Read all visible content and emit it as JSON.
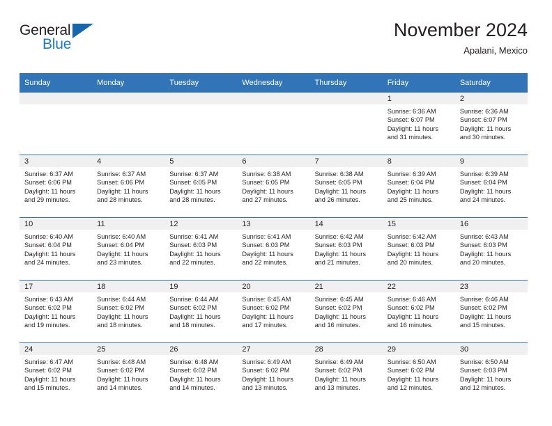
{
  "brand": {
    "name_part1": "General",
    "name_part2": "Blue",
    "triangle_color": "#1666ae",
    "blue_text_color": "#1f7bc1"
  },
  "header": {
    "title": "November 2024",
    "subtitle": "Apalani, Mexico"
  },
  "theme": {
    "header_bg": "#3174b8",
    "header_text": "#ffffff",
    "daynum_band_bg": "#f0f0f0",
    "cell_bg": "#ffffff",
    "divider": "#3174b8",
    "text": "#231f20"
  },
  "weekday_headers": [
    "Sunday",
    "Monday",
    "Tuesday",
    "Wednesday",
    "Thursday",
    "Friday",
    "Saturday"
  ],
  "labels": {
    "sunrise_prefix": "Sunrise:",
    "sunset_prefix": "Sunset:",
    "daylight_prefix": "Daylight:"
  },
  "weeks": [
    [
      {
        "empty": true
      },
      {
        "empty": true
      },
      {
        "empty": true
      },
      {
        "empty": true
      },
      {
        "empty": true
      },
      {
        "empty": false,
        "day": "1",
        "sunrise": "Sunrise: 6:36 AM",
        "sunset": "Sunset: 6:07 PM",
        "daylight_l1": "Daylight: 11 hours",
        "daylight_l2": "and 31 minutes."
      },
      {
        "empty": false,
        "day": "2",
        "sunrise": "Sunrise: 6:36 AM",
        "sunset": "Sunset: 6:07 PM",
        "daylight_l1": "Daylight: 11 hours",
        "daylight_l2": "and 30 minutes."
      }
    ],
    [
      {
        "empty": false,
        "day": "3",
        "sunrise": "Sunrise: 6:37 AM",
        "sunset": "Sunset: 6:06 PM",
        "daylight_l1": "Daylight: 11 hours",
        "daylight_l2": "and 29 minutes."
      },
      {
        "empty": false,
        "day": "4",
        "sunrise": "Sunrise: 6:37 AM",
        "sunset": "Sunset: 6:06 PM",
        "daylight_l1": "Daylight: 11 hours",
        "daylight_l2": "and 28 minutes."
      },
      {
        "empty": false,
        "day": "5",
        "sunrise": "Sunrise: 6:37 AM",
        "sunset": "Sunset: 6:05 PM",
        "daylight_l1": "Daylight: 11 hours",
        "daylight_l2": "and 28 minutes."
      },
      {
        "empty": false,
        "day": "6",
        "sunrise": "Sunrise: 6:38 AM",
        "sunset": "Sunset: 6:05 PM",
        "daylight_l1": "Daylight: 11 hours",
        "daylight_l2": "and 27 minutes."
      },
      {
        "empty": false,
        "day": "7",
        "sunrise": "Sunrise: 6:38 AM",
        "sunset": "Sunset: 6:05 PM",
        "daylight_l1": "Daylight: 11 hours",
        "daylight_l2": "and 26 minutes."
      },
      {
        "empty": false,
        "day": "8",
        "sunrise": "Sunrise: 6:39 AM",
        "sunset": "Sunset: 6:04 PM",
        "daylight_l1": "Daylight: 11 hours",
        "daylight_l2": "and 25 minutes."
      },
      {
        "empty": false,
        "day": "9",
        "sunrise": "Sunrise: 6:39 AM",
        "sunset": "Sunset: 6:04 PM",
        "daylight_l1": "Daylight: 11 hours",
        "daylight_l2": "and 24 minutes."
      }
    ],
    [
      {
        "empty": false,
        "day": "10",
        "sunrise": "Sunrise: 6:40 AM",
        "sunset": "Sunset: 6:04 PM",
        "daylight_l1": "Daylight: 11 hours",
        "daylight_l2": "and 24 minutes."
      },
      {
        "empty": false,
        "day": "11",
        "sunrise": "Sunrise: 6:40 AM",
        "sunset": "Sunset: 6:04 PM",
        "daylight_l1": "Daylight: 11 hours",
        "daylight_l2": "and 23 minutes."
      },
      {
        "empty": false,
        "day": "12",
        "sunrise": "Sunrise: 6:41 AM",
        "sunset": "Sunset: 6:03 PM",
        "daylight_l1": "Daylight: 11 hours",
        "daylight_l2": "and 22 minutes."
      },
      {
        "empty": false,
        "day": "13",
        "sunrise": "Sunrise: 6:41 AM",
        "sunset": "Sunset: 6:03 PM",
        "daylight_l1": "Daylight: 11 hours",
        "daylight_l2": "and 22 minutes."
      },
      {
        "empty": false,
        "day": "14",
        "sunrise": "Sunrise: 6:42 AM",
        "sunset": "Sunset: 6:03 PM",
        "daylight_l1": "Daylight: 11 hours",
        "daylight_l2": "and 21 minutes."
      },
      {
        "empty": false,
        "day": "15",
        "sunrise": "Sunrise: 6:42 AM",
        "sunset": "Sunset: 6:03 PM",
        "daylight_l1": "Daylight: 11 hours",
        "daylight_l2": "and 20 minutes."
      },
      {
        "empty": false,
        "day": "16",
        "sunrise": "Sunrise: 6:43 AM",
        "sunset": "Sunset: 6:03 PM",
        "daylight_l1": "Daylight: 11 hours",
        "daylight_l2": "and 20 minutes."
      }
    ],
    [
      {
        "empty": false,
        "day": "17",
        "sunrise": "Sunrise: 6:43 AM",
        "sunset": "Sunset: 6:02 PM",
        "daylight_l1": "Daylight: 11 hours",
        "daylight_l2": "and 19 minutes."
      },
      {
        "empty": false,
        "day": "18",
        "sunrise": "Sunrise: 6:44 AM",
        "sunset": "Sunset: 6:02 PM",
        "daylight_l1": "Daylight: 11 hours",
        "daylight_l2": "and 18 minutes."
      },
      {
        "empty": false,
        "day": "19",
        "sunrise": "Sunrise: 6:44 AM",
        "sunset": "Sunset: 6:02 PM",
        "daylight_l1": "Daylight: 11 hours",
        "daylight_l2": "and 18 minutes."
      },
      {
        "empty": false,
        "day": "20",
        "sunrise": "Sunrise: 6:45 AM",
        "sunset": "Sunset: 6:02 PM",
        "daylight_l1": "Daylight: 11 hours",
        "daylight_l2": "and 17 minutes."
      },
      {
        "empty": false,
        "day": "21",
        "sunrise": "Sunrise: 6:45 AM",
        "sunset": "Sunset: 6:02 PM",
        "daylight_l1": "Daylight: 11 hours",
        "daylight_l2": "and 16 minutes."
      },
      {
        "empty": false,
        "day": "22",
        "sunrise": "Sunrise: 6:46 AM",
        "sunset": "Sunset: 6:02 PM",
        "daylight_l1": "Daylight: 11 hours",
        "daylight_l2": "and 16 minutes."
      },
      {
        "empty": false,
        "day": "23",
        "sunrise": "Sunrise: 6:46 AM",
        "sunset": "Sunset: 6:02 PM",
        "daylight_l1": "Daylight: 11 hours",
        "daylight_l2": "and 15 minutes."
      }
    ],
    [
      {
        "empty": false,
        "day": "24",
        "sunrise": "Sunrise: 6:47 AM",
        "sunset": "Sunset: 6:02 PM",
        "daylight_l1": "Daylight: 11 hours",
        "daylight_l2": "and 15 minutes."
      },
      {
        "empty": false,
        "day": "25",
        "sunrise": "Sunrise: 6:48 AM",
        "sunset": "Sunset: 6:02 PM",
        "daylight_l1": "Daylight: 11 hours",
        "daylight_l2": "and 14 minutes."
      },
      {
        "empty": false,
        "day": "26",
        "sunrise": "Sunrise: 6:48 AM",
        "sunset": "Sunset: 6:02 PM",
        "daylight_l1": "Daylight: 11 hours",
        "daylight_l2": "and 14 minutes."
      },
      {
        "empty": false,
        "day": "27",
        "sunrise": "Sunrise: 6:49 AM",
        "sunset": "Sunset: 6:02 PM",
        "daylight_l1": "Daylight: 11 hours",
        "daylight_l2": "and 13 minutes."
      },
      {
        "empty": false,
        "day": "28",
        "sunrise": "Sunrise: 6:49 AM",
        "sunset": "Sunset: 6:02 PM",
        "daylight_l1": "Daylight: 11 hours",
        "daylight_l2": "and 13 minutes."
      },
      {
        "empty": false,
        "day": "29",
        "sunrise": "Sunrise: 6:50 AM",
        "sunset": "Sunset: 6:02 PM",
        "daylight_l1": "Daylight: 11 hours",
        "daylight_l2": "and 12 minutes."
      },
      {
        "empty": false,
        "day": "30",
        "sunrise": "Sunrise: 6:50 AM",
        "sunset": "Sunset: 6:03 PM",
        "daylight_l1": "Daylight: 11 hours",
        "daylight_l2": "and 12 minutes."
      }
    ]
  ]
}
